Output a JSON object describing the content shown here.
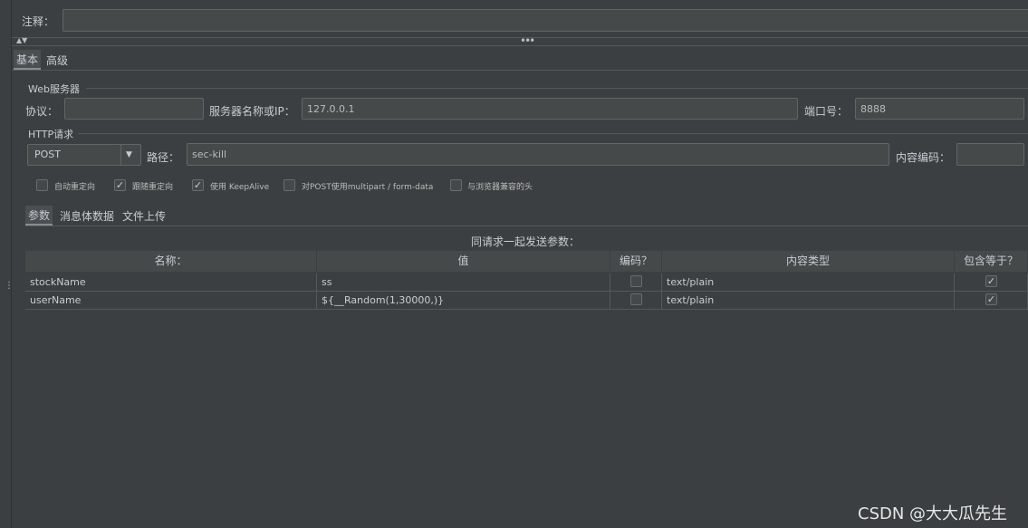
{
  "comment": {
    "label": "注释：",
    "value": ""
  },
  "tabs": {
    "basic": "基本",
    "advanced": "高级"
  },
  "web_server": {
    "title": "Web服务器",
    "protocol_label": "协议：",
    "protocol_value": "",
    "server_label": "服务器名称或IP：",
    "server_value": "127.0.0.1",
    "port_label": "端口号：",
    "port_value": "8888"
  },
  "http_request": {
    "title": "HTTP请求",
    "method": "POST",
    "path_label": "路径：",
    "path_value": "sec-kill",
    "encoding_label": "内容编码：",
    "encoding_value": ""
  },
  "options": [
    {
      "label": "自动重定向",
      "checked": false
    },
    {
      "label": "跟随重定向",
      "checked": true
    },
    {
      "label": "使用 KeepAlive",
      "checked": true
    },
    {
      "label": "对POST使用multipart / form-data",
      "checked": false
    },
    {
      "label": "与浏览器兼容的头",
      "checked": false
    }
  ],
  "sub_tabs": {
    "params": "参数",
    "body": "消息体数据",
    "files": "文件上传"
  },
  "table": {
    "caption": "同请求一起发送参数：",
    "headers": [
      "名称：",
      "值",
      "编码？",
      "内容类型",
      "包含等于？"
    ],
    "rows": [
      {
        "name": "stockName",
        "value": "ss",
        "encode": false,
        "content_type": "text/plain",
        "include_equals": true
      },
      {
        "name": "userName",
        "value": "${__Random(1,30000,)}",
        "encode": false,
        "content_type": "text/plain",
        "include_equals": true
      }
    ]
  },
  "watermark": "CSDN @大大瓜先生",
  "icons": {
    "check": "✓",
    "dropdown": "chevron-down-icon",
    "splitter": "grip-dots-icon",
    "collapse": "arrow-up-down-icon"
  }
}
